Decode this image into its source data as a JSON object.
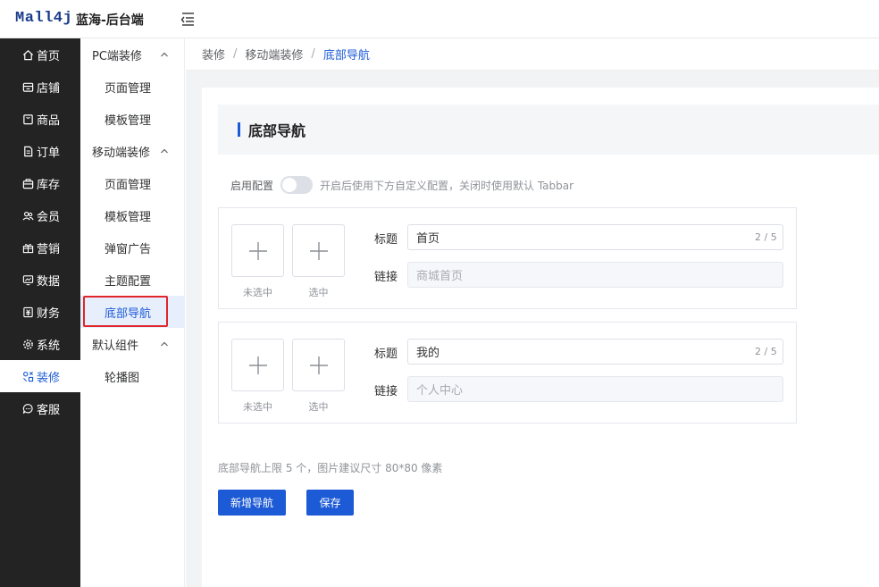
{
  "header": {
    "logo": "Mall4j",
    "app_name": "蓝海-后台端"
  },
  "sidebar": {
    "items": [
      {
        "label": "首页",
        "icon": "home-icon"
      },
      {
        "label": "店铺",
        "icon": "store-icon"
      },
      {
        "label": "商品",
        "icon": "goods-icon"
      },
      {
        "label": "订单",
        "icon": "order-icon"
      },
      {
        "label": "库存",
        "icon": "stock-icon"
      },
      {
        "label": "会员",
        "icon": "member-icon"
      },
      {
        "label": "营销",
        "icon": "gift-icon"
      },
      {
        "label": "数据",
        "icon": "data-icon"
      },
      {
        "label": "财务",
        "icon": "finance-icon"
      },
      {
        "label": "系统",
        "icon": "gear-icon"
      },
      {
        "label": "装修",
        "icon": "decorate-icon"
      },
      {
        "label": "客服",
        "icon": "chat-icon"
      }
    ],
    "active": "装修"
  },
  "submenu": {
    "group_pc": "PC端装修",
    "pc_page": "页面管理",
    "pc_template": "模板管理",
    "group_mobile": "移动端装修",
    "mobile_page": "页面管理",
    "mobile_template": "模板管理",
    "mobile_popup": "弹窗广告",
    "mobile_theme": "主题配置",
    "mobile_tabbar": "底部导航",
    "group_default": "默认组件",
    "default_carousel": "轮播图"
  },
  "breadcrumb": {
    "level1": "装修",
    "level2": "移动端装修",
    "current": "底部导航",
    "separator": "/"
  },
  "page": {
    "title": "底部导航",
    "enable_label": "启用配置",
    "enable_on": false,
    "enable_hint": "开启后使用下方自定义配置，关闭时使用默认 Tabbar"
  },
  "nav_items": [
    {
      "unselected_caption": "未选中",
      "selected_caption": "选中",
      "title_label": "标题",
      "title_value": "首页",
      "title_count": "2 / 5",
      "link_label": "链接",
      "link_placeholder": "商城首页"
    },
    {
      "unselected_caption": "未选中",
      "selected_caption": "选中",
      "title_label": "标题",
      "title_value": "我的",
      "title_count": "2 / 5",
      "link_label": "链接",
      "link_placeholder": "个人中心"
    }
  ],
  "footer": {
    "limit_tip": "底部导航上限 5 个，图片建议尺寸 80*80 像素",
    "add_button": "新增导航",
    "save_button": "保存"
  },
  "colors": {
    "sidebar_bg": "#232323",
    "accent": "#1d5bd6",
    "highlight": "#e0262b"
  }
}
